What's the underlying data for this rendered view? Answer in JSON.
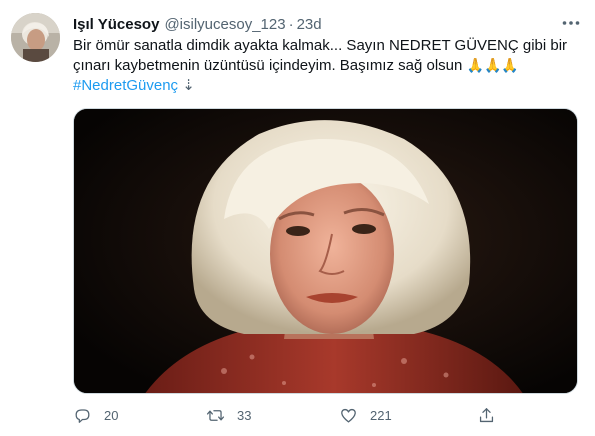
{
  "author": {
    "name": "Işıl Yücesoy",
    "handle": "@isilyucesoy_123",
    "separator": "·",
    "time": "23d"
  },
  "tweet": {
    "line1": "Bir ömür sanatla dimdik ayakta kalmak... Sayın NEDRET GÜVENÇ  gibi bir",
    "line2": "çınarı kaybetmenin üzüntüsü içindeyim. Başımız sağ olsun",
    "emoji": "🙏🙏🙏",
    "hashtag": "#NedretGüvenç",
    "hashtag_suffix": "⇣"
  },
  "actions": {
    "reply_count": "20",
    "retweet_count": "33",
    "like_count": "221"
  },
  "icons": {
    "more": "more-horizontal-icon",
    "reply": "reply-icon",
    "retweet": "retweet-icon",
    "like": "heart-icon",
    "share": "share-icon"
  },
  "colors": {
    "link": "#1d9bf0",
    "muted": "#536471",
    "text": "#0f1419"
  }
}
